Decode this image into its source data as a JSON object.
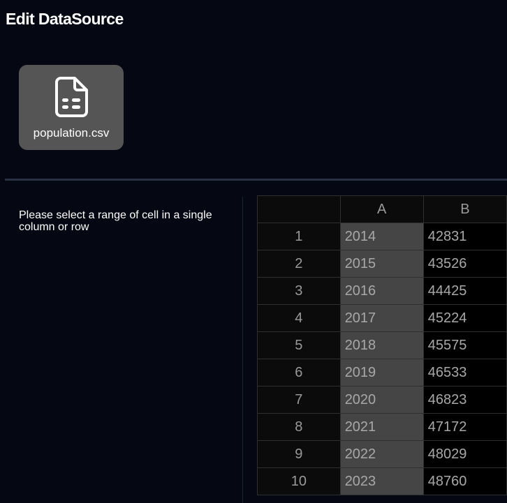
{
  "header": {
    "title": "Edit DataSource"
  },
  "file": {
    "name": "population.csv",
    "icon": "csv-file-icon"
  },
  "instruction": "Please select a range of cell in a single column or row",
  "grid": {
    "columns": [
      "A",
      "B"
    ],
    "rows": [
      {
        "num": "1",
        "a": "2014",
        "b": "42831"
      },
      {
        "num": "2",
        "a": "2015",
        "b": "43526"
      },
      {
        "num": "3",
        "a": "2016",
        "b": "44425"
      },
      {
        "num": "4",
        "a": "2017",
        "b": "45224"
      },
      {
        "num": "5",
        "a": "2018",
        "b": "45575"
      },
      {
        "num": "6",
        "a": "2019",
        "b": "46533"
      },
      {
        "num": "7",
        "a": "2020",
        "b": "46823"
      },
      {
        "num": "8",
        "a": "2021",
        "b": "47172"
      },
      {
        "num": "9",
        "a": "2022",
        "b": "48029"
      },
      {
        "num": "10",
        "a": "2023",
        "b": "48760"
      }
    ]
  },
  "colors": {
    "background": "#050812",
    "card": "#555555",
    "selected_column": "#454545",
    "divider": "#293142"
  }
}
